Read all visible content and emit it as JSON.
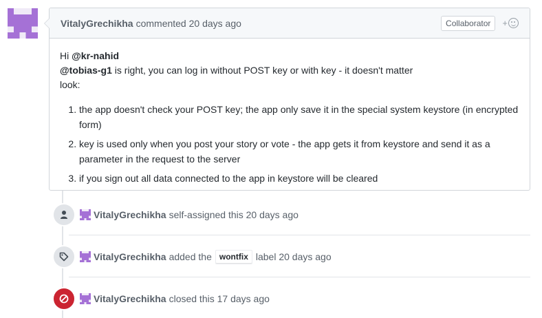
{
  "comment": {
    "author": "VitalyGrechikha",
    "action": "commented 20 days ago",
    "role_badge": "Collaborator",
    "reaction_plus": "+",
    "body": {
      "greeting": "Hi ",
      "mention1": "@kr-nahid",
      "mention2": "@tobias-g1",
      "line2_rest": " is right, you can log in without POST key or with key - it doesn't matter",
      "line3": "look:",
      "items": [
        "the app doesn't check your POST key; the app only save it in the special system keystore (in encrypted form)",
        "key is used only when you post your story or vote - the app gets it from keystore and send it as a parameter in the request to the server",
        "if you sign out all data connected to the app in keystore will be cleared"
      ]
    }
  },
  "events": [
    {
      "icon": "person-icon",
      "author": "VitalyGrechikha",
      "text": "self-assigned this 20 days ago"
    },
    {
      "icon": "tag-icon",
      "author": "VitalyGrechikha",
      "pre": "added the",
      "label": "wontfix",
      "post": "label 20 days ago"
    },
    {
      "icon": "circle-slash-icon",
      "author": "VitalyGrechikha",
      "text": "closed this 17 days ago"
    }
  ],
  "colors": {
    "avatar": "#a571d6",
    "closed": "#cb2431",
    "badge_bg": "#e1e4e8"
  }
}
